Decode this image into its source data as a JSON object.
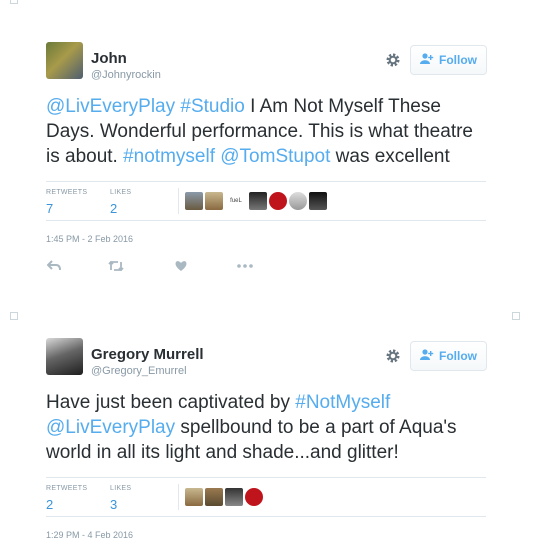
{
  "tweets": [
    {
      "name": "John",
      "handle": "@Johnyrockin",
      "follow_label": "Follow",
      "text_parts": [
        {
          "t": "@LivEveryPlay",
          "link": true
        },
        {
          "t": " ",
          "link": false
        },
        {
          "t": "#Studio",
          "link": true
        },
        {
          "t": " I Am Not Myself These Days. Wonderful performance. This is what theatre is about. ",
          "link": false
        },
        {
          "t": "#notmyself",
          "link": true
        },
        {
          "t": " ",
          "link": false
        },
        {
          "t": "@TomStupot",
          "link": true
        },
        {
          "t": " was excellent",
          "link": false
        }
      ],
      "retweets_label": "RETWEETS",
      "retweets": "7",
      "likes_label": "LIKES",
      "likes": "2",
      "liker_text": "fueL",
      "timestamp": "1:45 PM - 2 Feb 2016",
      "action_icons": [
        "reply-icon",
        "retweet-icon",
        "heart-icon",
        "more-icon"
      ]
    },
    {
      "name": "Gregory Murrell",
      "handle": "@Gregory_Emurrel",
      "follow_label": "Follow",
      "text_parts": [
        {
          "t": "Have just been captivated by ",
          "link": false
        },
        {
          "t": "#NotMyself",
          "link": true
        },
        {
          "t": " ",
          "link": false
        },
        {
          "t": "@LivEveryPlay",
          "link": true
        },
        {
          "t": " spellbound to be a part of Aqua's world in all its light and shade...and glitter!",
          "link": false
        }
      ],
      "retweets_label": "RETWEETS",
      "retweets": "2",
      "likes_label": "LIKES",
      "likes": "3",
      "timestamp": "1:29 PM - 4 Feb 2016"
    }
  ],
  "colors": {
    "link": "#55acee",
    "count": "#3b94d9",
    "muted": "#8899a6",
    "text": "#292f33",
    "border": "#e1e8ed"
  }
}
